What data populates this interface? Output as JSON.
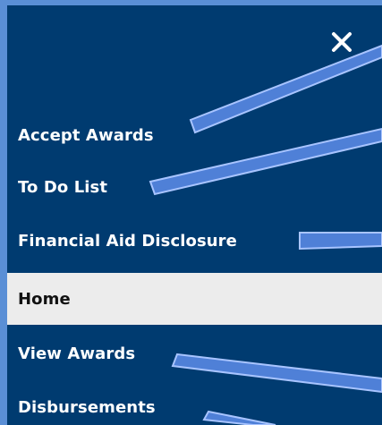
{
  "menu": {
    "close_symbol": "✕",
    "items": [
      {
        "label": "Accept Awards"
      },
      {
        "label": "To Do List"
      },
      {
        "label": "Financial Aid Disclosure"
      },
      {
        "label": "Home",
        "active": true
      },
      {
        "label": "View Awards"
      },
      {
        "label": "Disbursements"
      }
    ]
  },
  "colors": {
    "outer_border": "#5a8fd6",
    "panel_bg": "#003b70",
    "active_bg": "#ececec",
    "callout_fill": "#4f80d7",
    "callout_stroke": "#a8c4ff"
  },
  "icons": {
    "close": "close-icon"
  }
}
